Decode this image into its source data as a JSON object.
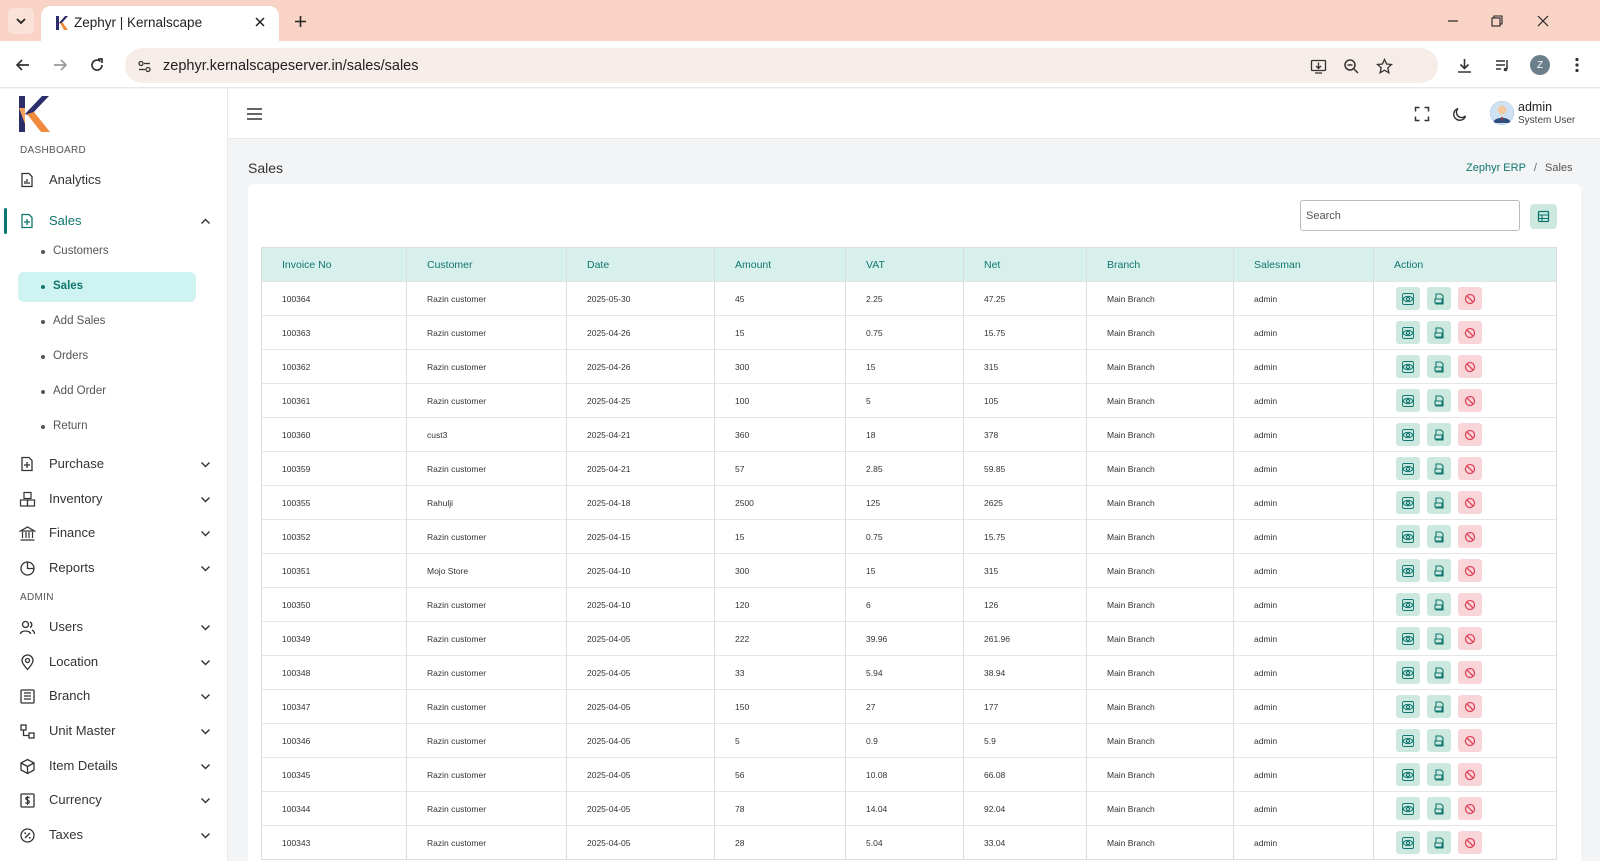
{
  "browser": {
    "tab_title": "Zephyr | Kernalscape",
    "url": "zephyr.kernalscapeserver.in/sales/sales",
    "profile_initial": "Z"
  },
  "sidebar": {
    "section_dashboard": "DASHBOARD",
    "section_admin": "ADMIN",
    "items": [
      {
        "label": "Analytics",
        "icon": "document-chart-icon"
      },
      {
        "label": "Sales",
        "icon": "document-plus-icon"
      },
      {
        "label": "Purchase",
        "icon": "document-plus-icon"
      },
      {
        "label": "Inventory",
        "icon": "boxes-icon"
      },
      {
        "label": "Finance",
        "icon": "bank-icon"
      },
      {
        "label": "Reports",
        "icon": "pie-chart-icon"
      },
      {
        "label": "Users",
        "icon": "users-icon"
      },
      {
        "label": "Location",
        "icon": "location-pin-icon"
      },
      {
        "label": "Branch",
        "icon": "building-icon"
      },
      {
        "label": "Unit Master",
        "icon": "shapes-icon"
      },
      {
        "label": "Item Details",
        "icon": "package-icon"
      },
      {
        "label": "Currency",
        "icon": "dollar-icon"
      },
      {
        "label": "Taxes",
        "icon": "percent-icon"
      }
    ],
    "sales_sub": [
      "Customers",
      "Sales",
      "Add Sales",
      "Orders",
      "Add Order",
      "Return"
    ]
  },
  "header": {
    "user_name": "admin",
    "user_role": "System User"
  },
  "page": {
    "title": "Sales",
    "breadcrumb_root": "Zephyr ERP",
    "breadcrumb_current": "Sales",
    "search_placeholder": "Search"
  },
  "table": {
    "columns": [
      "Invoice No",
      "Customer",
      "Date",
      "Amount",
      "VAT",
      "Net",
      "Branch",
      "Salesman",
      "Action"
    ],
    "rows": [
      [
        "100364",
        "Razin customer",
        "2025-05-30",
        "45",
        "2.25",
        "47.25",
        "Main Branch",
        "admin"
      ],
      [
        "100363",
        "Razin customer",
        "2025-04-26",
        "15",
        "0.75",
        "15.75",
        "Main Branch",
        "admin"
      ],
      [
        "100362",
        "Razin customer",
        "2025-04-26",
        "300",
        "15",
        "315",
        "Main Branch",
        "admin"
      ],
      [
        "100361",
        "Razin customer",
        "2025-04-25",
        "100",
        "5",
        "105",
        "Main Branch",
        "admin"
      ],
      [
        "100360",
        "cust3",
        "2025-04-21",
        "360",
        "18",
        "378",
        "Main Branch",
        "admin"
      ],
      [
        "100359",
        "Razin customer",
        "2025-04-21",
        "57",
        "2.85",
        "59.85",
        "Main Branch",
        "admin"
      ],
      [
        "100355",
        "Rahulji",
        "2025-04-18",
        "2500",
        "125",
        "2625",
        "Main Branch",
        "admin"
      ],
      [
        "100352",
        "Razin customer",
        "2025-04-15",
        "15",
        "0.75",
        "15.75",
        "Main Branch",
        "admin"
      ],
      [
        "100351",
        "Mojo Store",
        "2025-04-10",
        "300",
        "15",
        "315",
        "Main Branch",
        "admin"
      ],
      [
        "100350",
        "Razin customer",
        "2025-04-10",
        "120",
        "6",
        "126",
        "Main Branch",
        "admin"
      ],
      [
        "100349",
        "Razin customer",
        "2025-04-05",
        "222",
        "39.96",
        "261.96",
        "Main Branch",
        "admin"
      ],
      [
        "100348",
        "Razin customer",
        "2025-04-05",
        "33",
        "5.94",
        "38.94",
        "Main Branch",
        "admin"
      ],
      [
        "100347",
        "Razin customer",
        "2025-04-05",
        "150",
        "27",
        "177",
        "Main Branch",
        "admin"
      ],
      [
        "100346",
        "Razin customer",
        "2025-04-05",
        "5",
        "0.9",
        "5.9",
        "Main Branch",
        "admin"
      ],
      [
        "100345",
        "Razin customer",
        "2025-04-05",
        "56",
        "10.08",
        "66.08",
        "Main Branch",
        "admin"
      ],
      [
        "100344",
        "Razin customer",
        "2025-04-05",
        "78",
        "14.04",
        "92.04",
        "Main Branch",
        "admin"
      ],
      [
        "100343",
        "Razin customer",
        "2025-04-05",
        "28",
        "5.04",
        "33.04",
        "Main Branch",
        "admin"
      ]
    ]
  },
  "colors": {
    "accent": "#0f766e",
    "header_bg": "#d8f0ec",
    "tabstrip": "#f9d3c5",
    "cancel_bg": "#f8d5d8",
    "action_bg": "#cde9df"
  }
}
